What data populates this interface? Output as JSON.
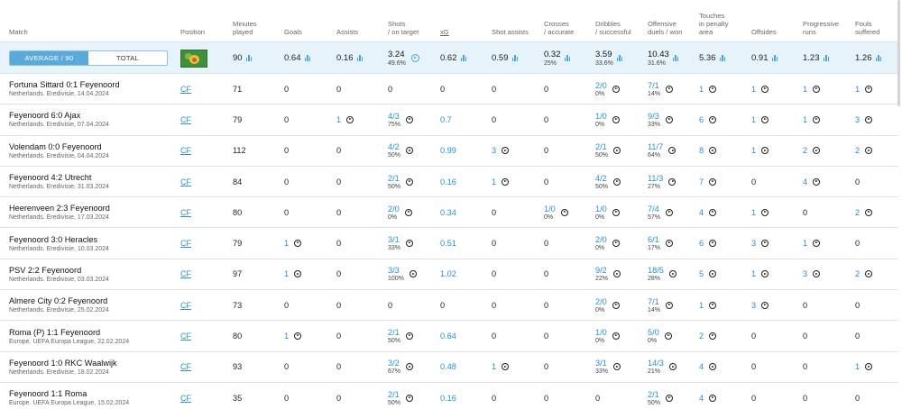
{
  "header": {
    "columns": [
      {
        "lines": [
          "Match"
        ]
      },
      {
        "lines": [
          "Position"
        ]
      },
      {
        "lines": [
          "Minutes",
          "played"
        ]
      },
      {
        "lines": [
          "Goals"
        ]
      },
      {
        "lines": [
          "Assists"
        ]
      },
      {
        "lines": [
          "Shots",
          "/ on target"
        ]
      },
      {
        "lines": [
          "xG"
        ]
      },
      {
        "lines": [
          "Shot assists"
        ]
      },
      {
        "lines": [
          "Crosses",
          "/ accurate"
        ]
      },
      {
        "lines": [
          "Dribbles",
          "/ successful"
        ]
      },
      {
        "lines": [
          "Offensive",
          "duels / won"
        ]
      },
      {
        "lines": [
          "Touches",
          "in penalty",
          "area"
        ]
      },
      {
        "lines": [
          "Offsides"
        ]
      },
      {
        "lines": [
          "Progressive",
          "runs"
        ]
      },
      {
        "lines": [
          "Fouls",
          "suffered"
        ]
      }
    ]
  },
  "toggle": {
    "average_label": "AVERAGE / 90",
    "total_label": "TOTAL",
    "active": "average"
  },
  "averages": {
    "minutes": "90",
    "goals": "0.64",
    "assists": "0.16",
    "shots": "3.24",
    "shots_pct": "49.6%",
    "xg": "0.62",
    "shot_assists": "0.59",
    "crosses": "0.32",
    "crosses_pct": "25%",
    "dribbles": "3.59",
    "dribbles_pct": "33.6%",
    "duels": "10.43",
    "duels_pct": "31.6%",
    "touches": "5.36",
    "offsides": "0.91",
    "progressive": "1.23",
    "fouls": "1.26"
  },
  "rows": [
    {
      "match": "Fortuna Sittard 0:1 Feyenoord",
      "comp": "Netherlands. Eredivisie, 14.04.2024",
      "position": "CF",
      "minutes": "71",
      "goals": "0",
      "assists": "0",
      "shots": "0",
      "shots_pct": "",
      "xg": "0",
      "shot_assists": "0",
      "crosses": "0",
      "crosses_pct": "",
      "dribbles": "2/0",
      "dribbles_pct": "0%",
      "duels": "7/1",
      "duels_pct": "14%",
      "touches": "1",
      "offsides": "1",
      "progressive": "1",
      "fouls": "1"
    },
    {
      "match": "Feyenoord 6:0 Ajax",
      "comp": "Netherlands. Eredivisie, 07.04.2024",
      "position": "CF",
      "minutes": "79",
      "goals": "0",
      "assists": "1",
      "shots": "4/3",
      "shots_pct": "75%",
      "xg": "0.7",
      "shot_assists": "0",
      "crosses": "0",
      "crosses_pct": "",
      "dribbles": "1/0",
      "dribbles_pct": "0%",
      "duels": "9/3",
      "duels_pct": "33%",
      "touches": "6",
      "offsides": "1",
      "progressive": "1",
      "fouls": "3"
    },
    {
      "match": "Volendam 0:0 Feyenoord",
      "comp": "Netherlands. Eredivisie, 04.04.2024",
      "position": "CF",
      "minutes": "112",
      "goals": "0",
      "assists": "0",
      "shots": "4/2",
      "shots_pct": "50%",
      "xg": "0.99",
      "shot_assists": "3",
      "crosses": "0",
      "crosses_pct": "",
      "dribbles": "2/1",
      "dribbles_pct": "50%",
      "duels": "11/7",
      "duels_pct": "64%",
      "touches": "8",
      "offsides": "1",
      "progressive": "2",
      "fouls": "2"
    },
    {
      "match": "Feyenoord 4:2 Utrecht",
      "comp": "Netherlands. Eredivisie, 31.03.2024",
      "position": "CF",
      "minutes": "84",
      "goals": "0",
      "assists": "0",
      "shots": "2/1",
      "shots_pct": "50%",
      "xg": "0.16",
      "shot_assists": "1",
      "crosses": "0",
      "crosses_pct": "",
      "dribbles": "4/2",
      "dribbles_pct": "50%",
      "duels": "11/3",
      "duels_pct": "27%",
      "touches": "7",
      "offsides": "0",
      "progressive": "4",
      "fouls": "0"
    },
    {
      "match": "Heerenveen 2:3 Feyenoord",
      "comp": "Netherlands. Eredivisie, 17.03.2024",
      "position": "CF",
      "minutes": "80",
      "goals": "0",
      "assists": "0",
      "shots": "2/0",
      "shots_pct": "0%",
      "xg": "0.34",
      "shot_assists": "0",
      "crosses": "1/0",
      "crosses_pct": "0%",
      "dribbles": "1/0",
      "dribbles_pct": "0%",
      "duels": "7/4",
      "duels_pct": "57%",
      "touches": "4",
      "offsides": "1",
      "progressive": "0",
      "fouls": "2"
    },
    {
      "match": "Feyenoord 3:0 Heracles",
      "comp": "Netherlands. Eredivisie, 10.03.2024",
      "position": "CF",
      "minutes": "79",
      "goals": "1",
      "assists": "0",
      "shots": "3/1",
      "shots_pct": "33%",
      "xg": "0.51",
      "shot_assists": "0",
      "crosses": "0",
      "crosses_pct": "",
      "dribbles": "2/0",
      "dribbles_pct": "0%",
      "duels": "6/1",
      "duels_pct": "17%",
      "touches": "6",
      "offsides": "3",
      "progressive": "1",
      "fouls": "0"
    },
    {
      "match": "PSV 2:2 Feyenoord",
      "comp": "Netherlands. Eredivisie, 03.03.2024",
      "position": "CF",
      "minutes": "97",
      "goals": "1",
      "assists": "0",
      "shots": "3/3",
      "shots_pct": "100%",
      "xg": "1.02",
      "shot_assists": "0",
      "crosses": "0",
      "crosses_pct": "",
      "dribbles": "9/2",
      "dribbles_pct": "22%",
      "duels": "18/5",
      "duels_pct": "28%",
      "touches": "5",
      "offsides": "1",
      "progressive": "3",
      "fouls": "2"
    },
    {
      "match": "Almere City 0:2 Feyenoord",
      "comp": "Netherlands. Eredivisie, 25.02.2024",
      "position": "CF",
      "minutes": "73",
      "goals": "0",
      "assists": "0",
      "shots": "0",
      "shots_pct": "",
      "xg": "0",
      "shot_assists": "0",
      "crosses": "0",
      "crosses_pct": "",
      "dribbles": "2/0",
      "dribbles_pct": "0%",
      "duels": "7/1",
      "duels_pct": "14%",
      "touches": "1",
      "offsides": "3",
      "progressive": "0",
      "fouls": "0"
    },
    {
      "match": "Roma (P) 1:1 Feyenoord",
      "comp": "Europe. UEFA Europa League, 22.02.2024",
      "position": "CF",
      "minutes": "80",
      "goals": "1",
      "assists": "0",
      "shots": "2/1",
      "shots_pct": "50%",
      "xg": "0.64",
      "shot_assists": "0",
      "crosses": "0",
      "crosses_pct": "",
      "dribbles": "1/0",
      "dribbles_pct": "0%",
      "duels": "5/0",
      "duels_pct": "0%",
      "touches": "2",
      "offsides": "0",
      "progressive": "0",
      "fouls": "0"
    },
    {
      "match": "Feyenoord 1:0 RKC Waalwijk",
      "comp": "Netherlands. Eredivisie, 18.02.2024",
      "position": "CF",
      "minutes": "93",
      "goals": "0",
      "assists": "0",
      "shots": "3/2",
      "shots_pct": "67%",
      "xg": "0.48",
      "shot_assists": "1",
      "crosses": "0",
      "crosses_pct": "",
      "dribbles": "3/1",
      "dribbles_pct": "33%",
      "duels": "14/3",
      "duels_pct": "21%",
      "touches": "4",
      "offsides": "0",
      "progressive": "0",
      "fouls": "1"
    },
    {
      "match": "Feyenoord 1:1 Roma",
      "comp": "Europe. UEFA Europa League, 15.02.2024",
      "position": "CF",
      "minutes": "35",
      "goals": "0",
      "assists": "0",
      "shots": "2/1",
      "shots_pct": "50%",
      "xg": "0.16",
      "shot_assists": "0",
      "crosses": "0",
      "crosses_pct": "",
      "dribbles": "0",
      "dribbles_pct": "",
      "duels": "2/1",
      "duels_pct": "50%",
      "touches": "4",
      "offsides": "0",
      "progressive": "0",
      "fouls": "0"
    }
  ]
}
